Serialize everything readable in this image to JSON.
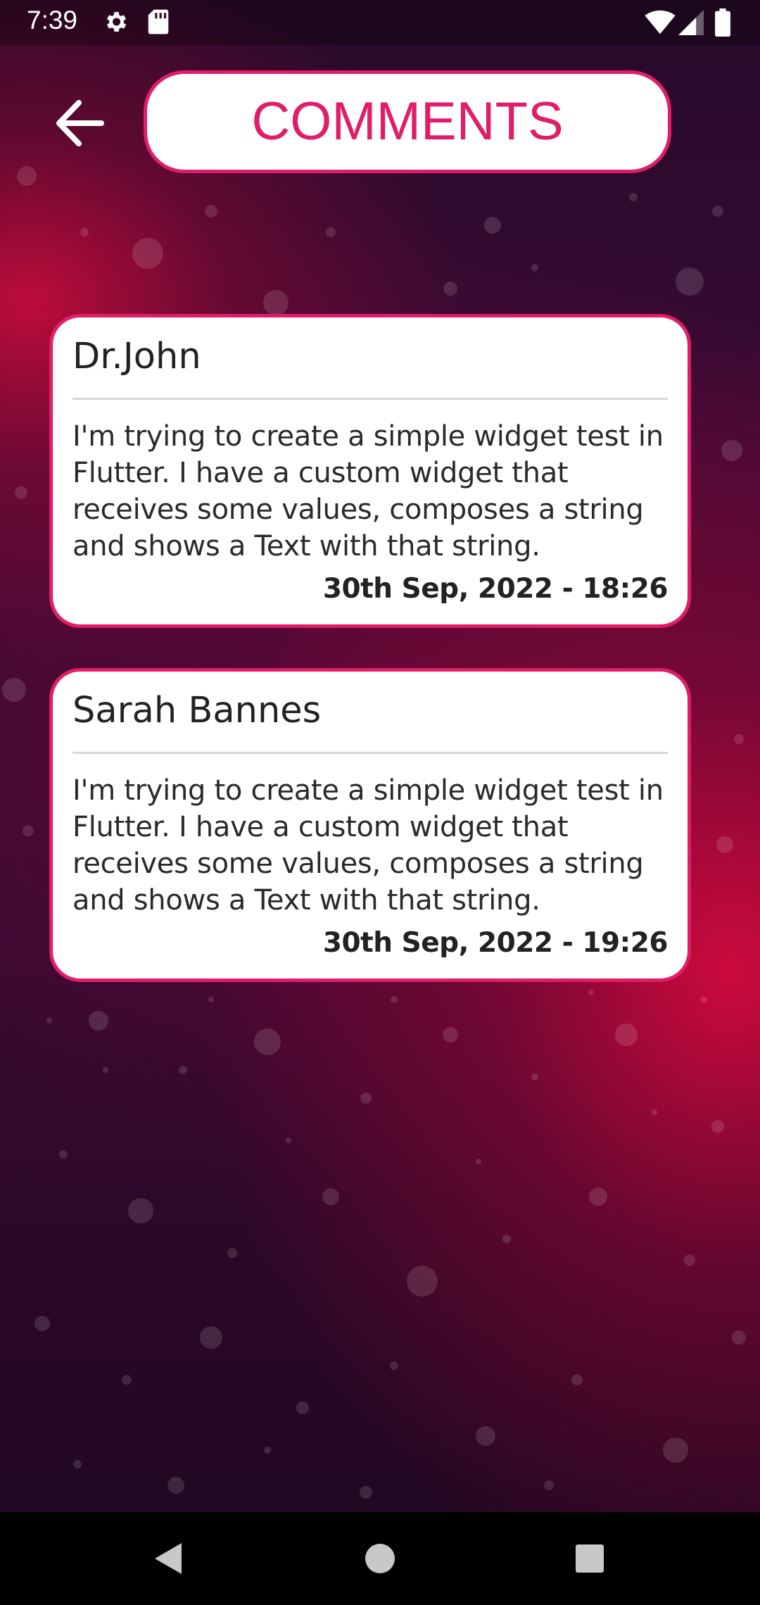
{
  "status_bar": {
    "time": "7:39"
  },
  "header": {
    "back_icon": "arrow-left-icon",
    "title": "COMMENTS"
  },
  "comments": [
    {
      "author": "Dr.John",
      "text": "I'm trying to create a simple widget test in Flutter. I have a custom widget that receives some values, composes a string and shows a Text with that string.",
      "date": "30th Sep, 2022 - 18:26"
    },
    {
      "author": "Sarah Bannes",
      "text": "I'm trying to create a simple widget test in Flutter. I have a custom widget that receives some values, composes a string and shows a Text with that string.",
      "date": "30th Sep, 2022 - 19:26"
    }
  ],
  "colors": {
    "accent": "#e21d67",
    "card_background": "#ffffff",
    "background_dark": "#2a0828",
    "background_glow": "#d60c3c"
  },
  "icons": {
    "status": [
      "settings-gear-icon",
      "sd-card-icon",
      "wifi-icon",
      "signal-icon",
      "battery-icon"
    ],
    "navigation": [
      "nav-back-icon",
      "nav-home-icon",
      "nav-recents-icon"
    ]
  }
}
